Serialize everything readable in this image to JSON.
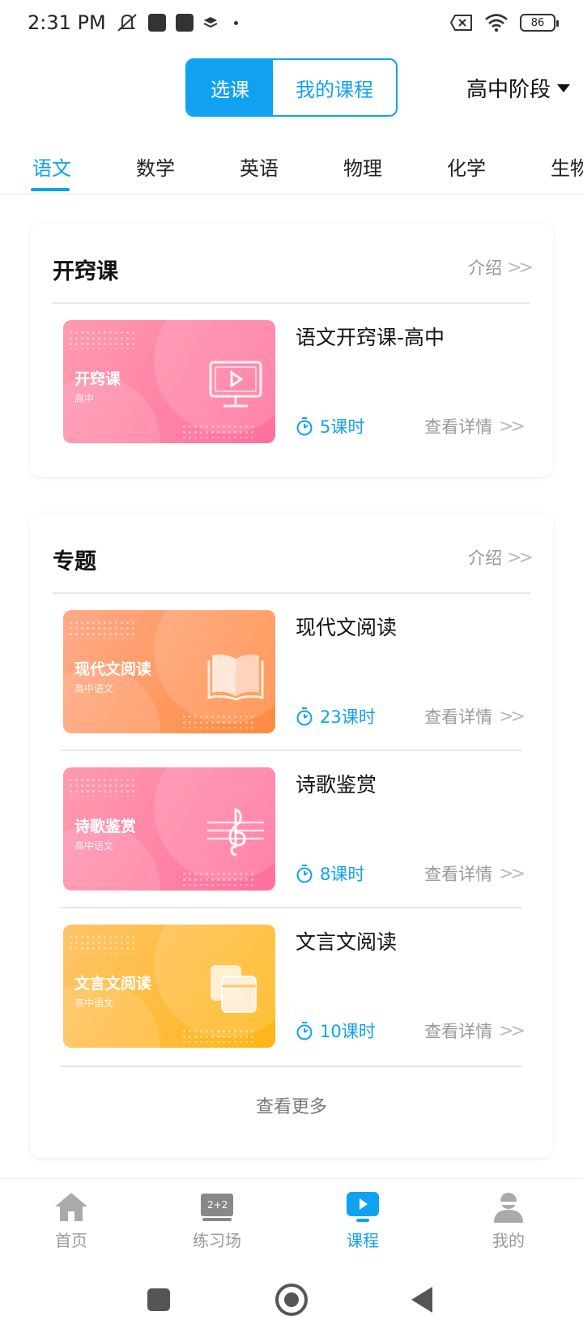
{
  "status_bar": {
    "time": "2:31 PM",
    "battery": "86"
  },
  "header": {
    "segments": [
      {
        "label": "选课",
        "active": true
      },
      {
        "label": "我的课程",
        "active": false
      }
    ],
    "stage": "高中阶段"
  },
  "subjects": [
    "语文",
    "数学",
    "英语",
    "物理",
    "化学",
    "生物"
  ],
  "sections": [
    {
      "title": "开窍课",
      "intro": "介绍",
      "courses": [
        {
          "thumb_title": "开窍课",
          "thumb_sub": "高中",
          "name": "语文开窍课-高中",
          "hours": "5课时",
          "detail": "查看详情",
          "theme": "pink",
          "icon": "play-screen-icon"
        }
      ]
    },
    {
      "title": "专题",
      "intro": "介绍",
      "courses": [
        {
          "thumb_title": "现代文阅读",
          "thumb_sub": "高中语文",
          "name": "现代文阅读",
          "hours": "23课时",
          "detail": "查看详情",
          "theme": "orange",
          "icon": "open-book-icon"
        },
        {
          "thumb_title": "诗歌鉴赏",
          "thumb_sub": "高中语文",
          "name": "诗歌鉴赏",
          "hours": "8课时",
          "detail": "查看详情",
          "theme": "pink",
          "icon": "treble-clef-icon"
        },
        {
          "thumb_title": "文言文阅读",
          "thumb_sub": "高中语文",
          "name": "文言文阅读",
          "hours": "10课时",
          "detail": "查看详情",
          "theme": "yellow",
          "icon": "scroll-books-icon"
        }
      ],
      "more": "查看更多"
    }
  ],
  "bottom_nav": [
    {
      "label": "首页",
      "icon": "home-icon",
      "active": false
    },
    {
      "label": "练习场",
      "icon": "blackboard-icon",
      "active": false
    },
    {
      "label": "课程",
      "icon": "course-play-icon",
      "active": true
    },
    {
      "label": "我的",
      "icon": "profile-icon",
      "active": false
    }
  ],
  "colors": {
    "accent": "#10a2f1",
    "pink_from": "#ff9bb0",
    "pink_to": "#ff6f9c",
    "orange_from": "#ffaa8a",
    "orange_to": "#ff8a3d",
    "yellow_from": "#ffc46a",
    "yellow_to": "#ffb514"
  }
}
